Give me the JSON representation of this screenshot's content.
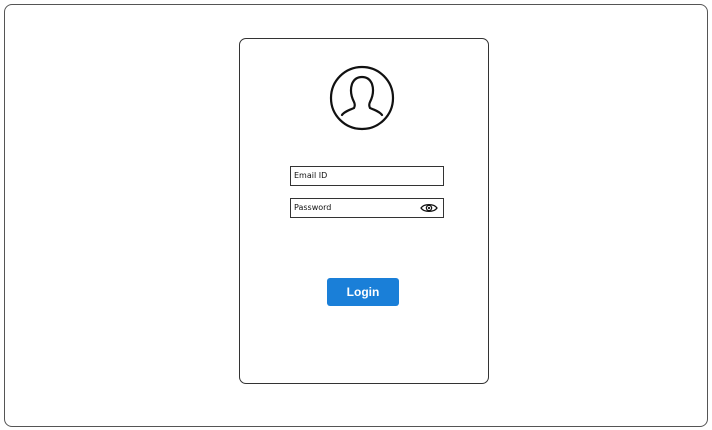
{
  "login_form": {
    "avatar_icon": "user-avatar-icon",
    "email": {
      "placeholder": "Email ID"
    },
    "password": {
      "placeholder": "Password",
      "toggle_icon": "eye-icon"
    },
    "login_button": {
      "label": "Login",
      "color": "#1a7fd8"
    }
  }
}
